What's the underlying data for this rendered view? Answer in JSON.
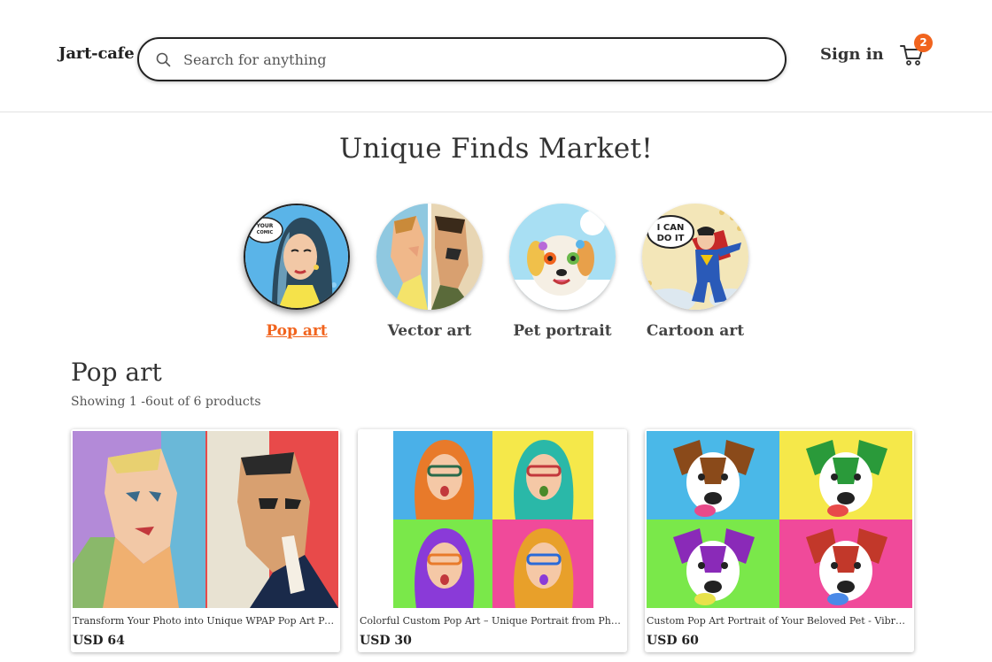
{
  "header": {
    "logo": "Jart-cafe",
    "search": {
      "placeholder": "Search for anything",
      "value": "",
      "icon": "search-icon"
    },
    "signin_label": "Sign in",
    "cart": {
      "icon": "cart-icon",
      "count": "2"
    }
  },
  "headline": "Unique Finds Market!",
  "categories": [
    {
      "label": "Pop art",
      "active": true
    },
    {
      "label": "Vector art",
      "active": false
    },
    {
      "label": "Pet portrait",
      "active": false
    },
    {
      "label": "Cartoon art",
      "active": false
    }
  ],
  "section": {
    "title": "Pop art",
    "showing": "Showing 1 -6out of 6 products"
  },
  "products": [
    {
      "title": "Transform Your Photo into Unique WPAP Pop Art Portrait – Custom Portrait",
      "price": "USD 64"
    },
    {
      "title": "Colorful Custom Pop Art – Unique Portrait from Photo, „Andy Warhol style",
      "price": "USD 30"
    },
    {
      "title": "Custom Pop Art Portrait of Your Beloved Pet - Vibrant & Unique Artwork",
      "price": "USD 60"
    }
  ],
  "colors": {
    "accent": "#f1641e",
    "text": "#222222",
    "border": "#e2e2e2"
  }
}
